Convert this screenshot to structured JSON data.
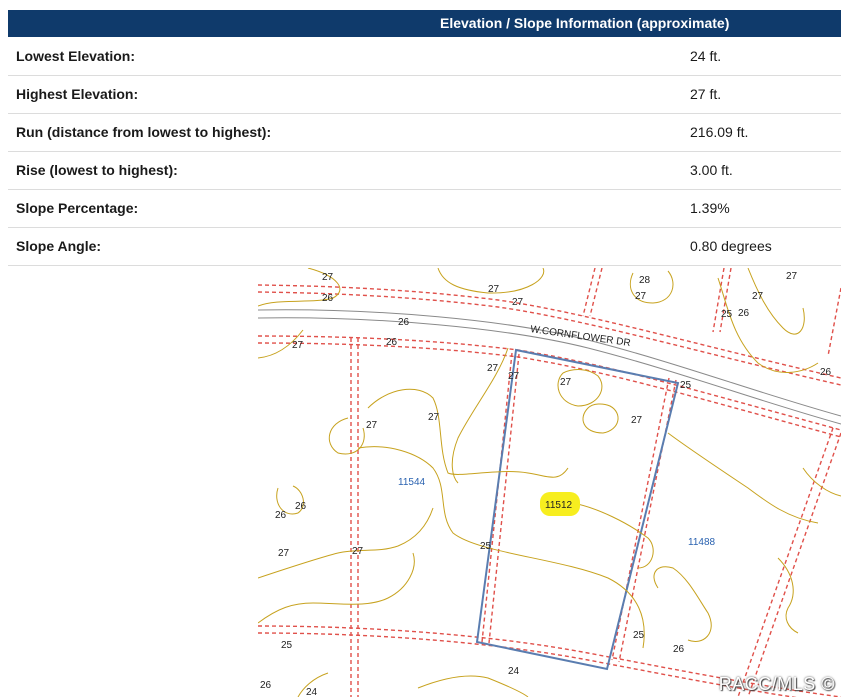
{
  "header": {
    "title": "Elevation / Slope Information (approximate)"
  },
  "rows": [
    {
      "label": "Lowest Elevation:",
      "value": "24 ft."
    },
    {
      "label": "Highest Elevation:",
      "value": "27 ft."
    },
    {
      "label": "Run (distance from lowest to highest):",
      "value": "216.09 ft."
    },
    {
      "label": "Rise (lowest to highest):",
      "value": "3.00 ft."
    },
    {
      "label": "Slope Percentage:",
      "value": "1.39%"
    },
    {
      "label": "Slope Angle:",
      "value": "0.80 degrees"
    }
  ],
  "map": {
    "street_label": "W.CORNFLOWER DR",
    "parcels": {
      "left": "11544",
      "highlighted": "11512",
      "right": "11488"
    },
    "contour_labels": [
      "27",
      "26",
      "27",
      "27",
      "28",
      "27",
      "27",
      "27",
      "26",
      "27",
      "26",
      "25",
      "26",
      "27",
      "27",
      "27",
      "27",
      "25",
      "26",
      "27",
      "26",
      "26",
      "27",
      "27",
      "25",
      "25",
      "26",
      "25",
      "24",
      "24",
      "26",
      "27"
    ],
    "highlight_color": "#f7ee1f",
    "contour_color": "#c7a21e",
    "lot_line_color": "#e0504a",
    "parcel_color": "#5a7db0"
  },
  "watermark": "RACC/MLS ©"
}
